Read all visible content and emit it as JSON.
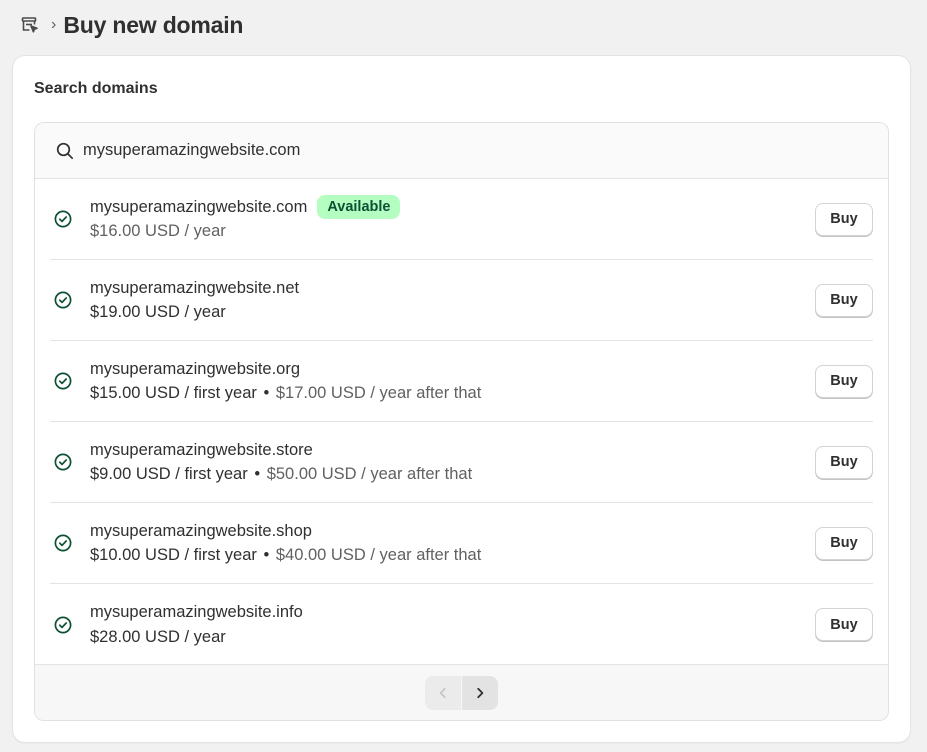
{
  "header": {
    "store_icon": "store-icon",
    "separator": "›",
    "title": "Buy new domain"
  },
  "card": {
    "title": "Search domains"
  },
  "search": {
    "icon": "search-icon",
    "value": "mysuperamazingwebsite.com"
  },
  "domains": [
    {
      "name": "mysuperamazingwebsite.com",
      "badge": "Available",
      "price": "$16.00 USD / year",
      "price_style": "muted",
      "buy_label": "Buy"
    },
    {
      "name": "mysuperamazingwebsite.net",
      "price": "$19.00 USD / year",
      "buy_label": "Buy"
    },
    {
      "name": "mysuperamazingwebsite.org",
      "price": "$15.00 USD / first year",
      "renewal": "$17.00 USD / year after that",
      "buy_label": "Buy"
    },
    {
      "name": "mysuperamazingwebsite.store",
      "price": "$9.00 USD / first year",
      "renewal": "$50.00 USD / year after that",
      "buy_label": "Buy"
    },
    {
      "name": "mysuperamazingwebsite.shop",
      "price": "$10.00 USD / first year",
      "renewal": "$40.00 USD / year after that",
      "buy_label": "Buy"
    },
    {
      "name": "mysuperamazingwebsite.info",
      "price": "$28.00 USD / year",
      "buy_label": "Buy"
    }
  ],
  "bullet": "•",
  "pagination": {
    "prev_icon": "chevron-left-icon",
    "next_icon": "chevron-right-icon"
  },
  "colors": {
    "badge_bg": "#b4fec2",
    "badge_text": "#0c5132",
    "check": "#0c5132"
  }
}
